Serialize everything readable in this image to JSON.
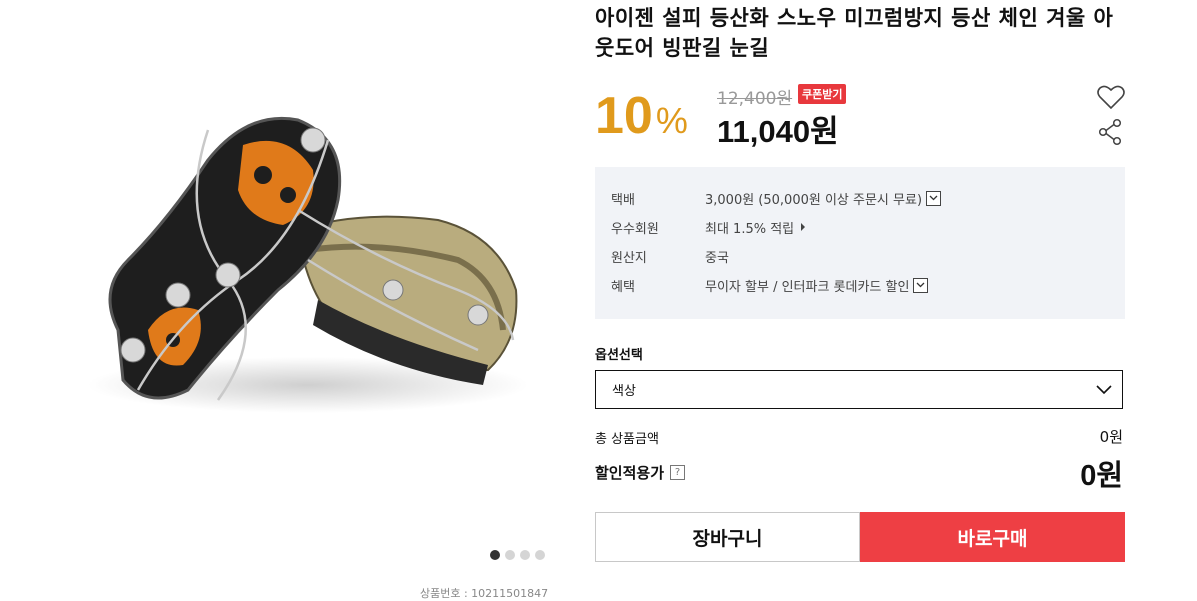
{
  "product": {
    "title": "아이젠 설피 등산화 스노우 미끄럼방지 등산 체인 겨울 아웃도어 빙판길 눈길",
    "product_no": "상품번호 : 10211501847",
    "image_icon": "shoe-crampon-photo",
    "gallery": {
      "count": 4,
      "active_index": 0
    }
  },
  "price": {
    "discount_num": "10",
    "discount_pct": "%",
    "original": "12,400원",
    "coupon": "쿠폰받기",
    "sale": "11,040원",
    "accent": "#e09a1c"
  },
  "actions": {
    "wish_icon": "heart-icon",
    "share_icon": "share-icon"
  },
  "info": [
    {
      "label": "택배",
      "value": "3,000원 (50,000원 이상 주문시 무료)"
    },
    {
      "label": "우수회원",
      "value": "최대 1.5% 적립"
    },
    {
      "label": "원산지",
      "value": "중국"
    },
    {
      "label": "혜택",
      "value": "무이자 할부 / 인터파크 롯데카드 할인"
    }
  ],
  "option": {
    "label": "옵션선택",
    "selected": "색상"
  },
  "totals": {
    "total_label": "총 상품금액",
    "total_value": "0원",
    "discount_label": "할인적용가",
    "help": "?",
    "discount_value": "0원"
  },
  "buttons": {
    "cart": "장바구니",
    "buy": "바로구매",
    "buy_color": "#ee3f44"
  }
}
